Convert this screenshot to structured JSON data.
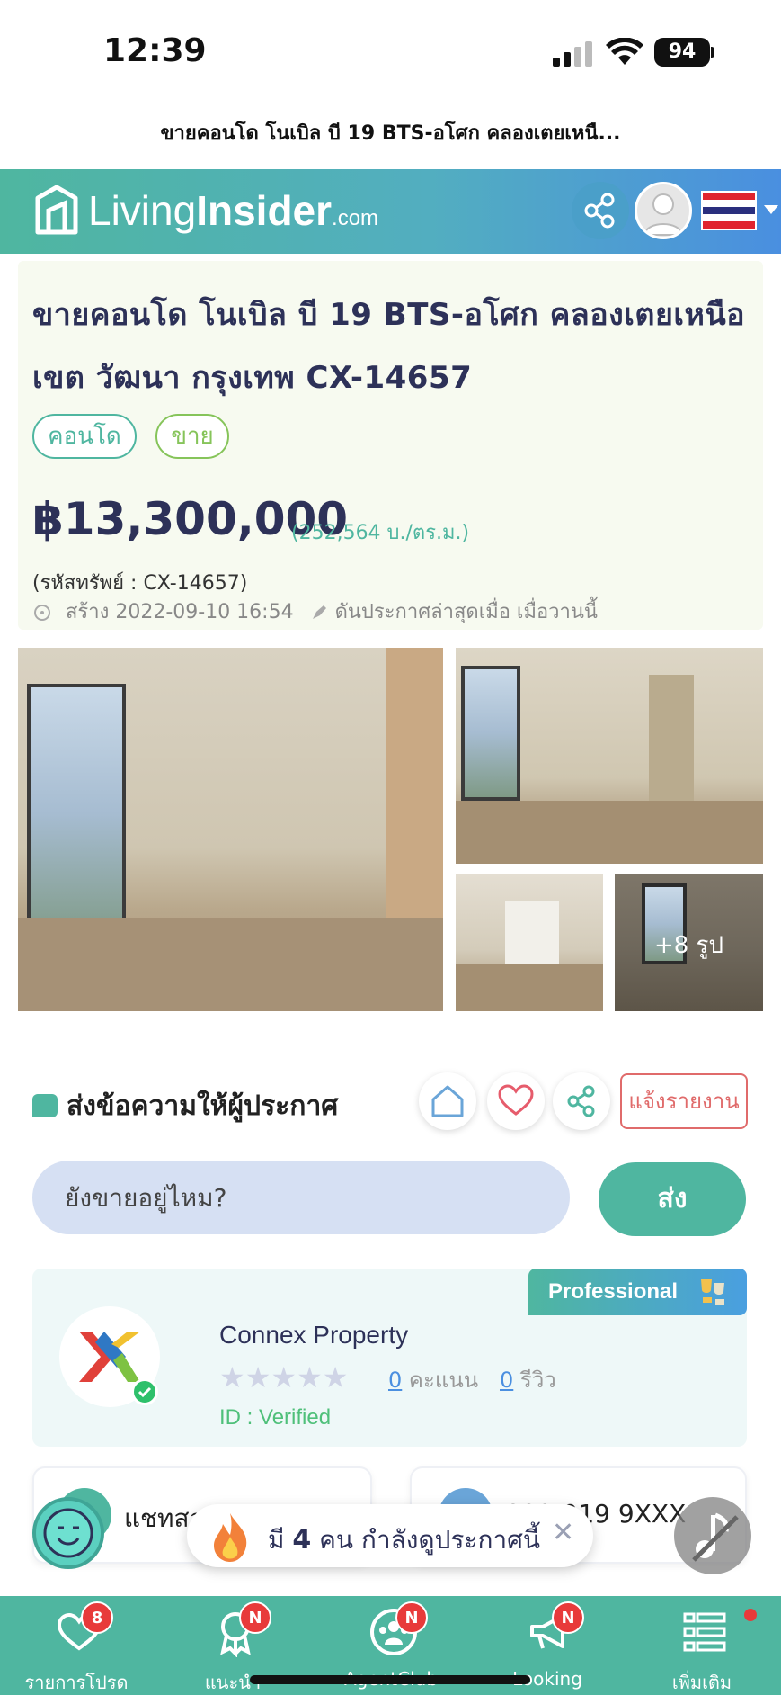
{
  "status_bar": {
    "time": "12:39",
    "battery": "94"
  },
  "browser": {
    "page_title": "ขายคอนโด โนเบิล บี 19 BTS-อโศก คลองเตยเหนื..."
  },
  "header": {
    "logo_light": "Living",
    "logo_bold": "Insider",
    "logo_suffix": ".com"
  },
  "listing": {
    "title": "ขายคอนโด โนเบิล บี 19 BTS-อโศก คลองเตยเหนือ เขต วัฒนา กรุงเทพ CX-14657",
    "tags": [
      "คอนโด",
      "ขาย"
    ],
    "price": "฿13,300,000",
    "price_per_sqm": "(252,564 บ./ตร.ม.)",
    "property_code": "(รหัสทรัพย์ : CX-14657)",
    "created": "สร้าง 2022-09-10 16:54",
    "boosted": "ดันประกาศล่าสุดเมื่อ เมื่อวานนี้",
    "more_photos": "+8 รูป"
  },
  "message": {
    "heading": "ส่งข้อความให้ผู้ประกาศ",
    "report_label": "แจ้งรายงาน",
    "input_placeholder": "ยังขายอยู่ไหม?",
    "send_label": "ส่ง"
  },
  "agent": {
    "badge": "Professional",
    "name": "Connex Property",
    "score_count": "0",
    "score_label": "คะแนน",
    "review_count": "0",
    "review_label": "รีวิว",
    "id_status": "ID : Verified",
    "rating": 0
  },
  "contact": {
    "chat_label": "แชทสอ",
    "phone_label": "099-919 9XXX"
  },
  "toast": {
    "prefix": "มี",
    "count": "4",
    "suffix": "คน กำลังดูประกาศนี้"
  },
  "bottom_nav": [
    {
      "label": "รายการโปรด",
      "badge": "8",
      "icon": "heart-icon"
    },
    {
      "label": "แนะนำ",
      "badge": "N",
      "icon": "ribbon-icon"
    },
    {
      "label": "AgentClub",
      "badge": "N",
      "icon": "group-icon"
    },
    {
      "label": "Looking",
      "badge": "N",
      "icon": "megaphone-icon"
    },
    {
      "label": "เพิ่มเติม",
      "badge": "",
      "icon": "menu-icon"
    }
  ],
  "colors": {
    "brand": "#4fb6a0",
    "title": "#2d3158",
    "badge_red": "#e83a3a",
    "report": "#e06b6b",
    "verified": "#4fc07a"
  }
}
